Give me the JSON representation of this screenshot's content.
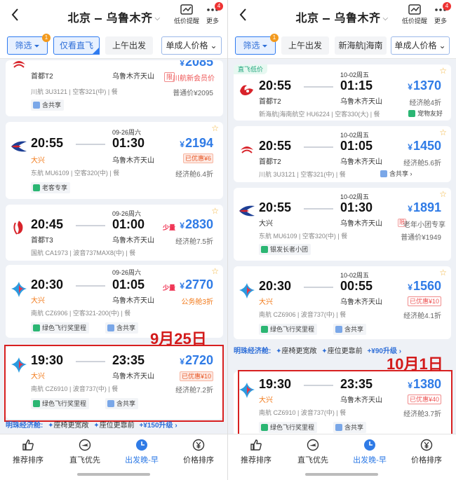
{
  "left": {
    "header": {
      "from": "北京",
      "to": "乌鲁木齐",
      "low_price_label": "低价提醒",
      "more_label": "更多",
      "more_badge": "4"
    },
    "filters": [
      {
        "label": "筛选",
        "badge": "1",
        "funnel": "⏷"
      },
      {
        "label": "仅看直飞"
      },
      {
        "label": "上午出发"
      },
      {
        "label": "单成人价格",
        "chev": "⌄"
      }
    ],
    "cards": [
      {
        "dep_airport": "首都T2",
        "arr_airport": "乌鲁木齐天山",
        "flight": "川航 3U3121 | 空客321(中) | 餐",
        "price": "2085",
        "tag": "限",
        "tag_text": "川航新会员价",
        "discount": "普通价¥2095",
        "chip": "含共享"
      },
      {
        "date": "09-26周六",
        "dep_time": "20:55",
        "arr_time": "01:30",
        "dep_airport": "大兴",
        "arr_airport": "乌鲁木齐天山",
        "flight": "东航 MU6109 | 空客320(中) | 餐",
        "price": "2194",
        "tag": "已优惠¥6",
        "discount": "经济舱6.4折",
        "chip": "老客专享"
      },
      {
        "date": "09-26周六",
        "dep_time": "20:45",
        "arr_time": "01:00",
        "dep_airport": "首都T3",
        "arr_airport": "乌鲁木齐天山",
        "flight": "国航 CA1973 | 波音737MAX8(中) | 餐",
        "price": "2830",
        "few": "少量",
        "discount": "经济舱7.5折"
      },
      {
        "date": "09-26周六",
        "dep_time": "20:30",
        "arr_time": "01:05",
        "dep_airport": "大兴",
        "arr_airport": "乌鲁木齐天山",
        "flight": "南航 CZ6906 | 空客321-200(中) | 餐",
        "price": "2770",
        "few": "少量",
        "discount": "公务舱3折",
        "chip": "绿色飞行奖里程",
        "chip_b": "含共享"
      },
      {
        "dep_time": "19:30",
        "arr_time": "23:35",
        "dep_airport": "大兴",
        "arr_airport": "乌鲁木齐天山",
        "flight": "南航 CZ6910 | 波音737(中) | 餐",
        "price": "2720",
        "tag": "已优惠¥10",
        "discount": "经济舱7.2折",
        "chip": "绿色飞行奖里程",
        "chip_b": "含共享"
      }
    ],
    "promo": {
      "label": "明珠经济舱:",
      "a": "座椅更宽敞",
      "b": "座位更靠前",
      "up": "+¥150升级 ›"
    },
    "annotation": "9月25日",
    "nav": [
      "推荐排序",
      "直飞优先",
      "出发晚-早",
      "价格排序"
    ]
  },
  "right": {
    "header": {
      "from": "北京",
      "to": "乌鲁木齐",
      "low_price_label": "低价提醒",
      "more_label": "更多",
      "more_badge": "4"
    },
    "filters": [
      {
        "label": "筛选",
        "badge": "1",
        "funnel": "⏷"
      },
      {
        "label": "上午出发"
      },
      {
        "label": "新海航|海南"
      },
      {
        "label": "单成人价格",
        "chev": "⌄"
      }
    ],
    "cards": [
      {
        "badge": "直飞低价",
        "date": "10-02周五",
        "dep_time": "20:55",
        "arr_time": "01:15",
        "dep_airport": "首都T2",
        "arr_airport": "乌鲁木齐天山",
        "flight": "新海航|海南航空 HU6224 | 空客330(大) | 餐",
        "price": "1370",
        "discount": "经济舱4折",
        "chip": "宠物友好"
      },
      {
        "date": "10-02周五",
        "dep_time": "20:55",
        "arr_time": "01:05",
        "dep_airport": "首都T2",
        "arr_airport": "乌鲁木齐天山",
        "flight": "川航 3U3121 | 空客321(中) | 餐",
        "price": "1450",
        "discount": "经济舱5.6折",
        "chip": "含共享 ›"
      },
      {
        "date": "10-02周五",
        "dep_time": "20:55",
        "arr_time": "01:30",
        "dep_airport": "大兴",
        "arr_airport": "乌鲁木齐天山",
        "flight": "东航 MU6109 | 空客320(中) | 餐",
        "price": "1891",
        "tag": "限",
        "tag_text": "老年小团专享",
        "discount": "普通价¥1949",
        "chip": "银发长者小团"
      },
      {
        "date": "10-02周五",
        "dep_time": "20:30",
        "arr_time": "00:55",
        "dep_airport": "大兴",
        "arr_airport": "乌鲁木齐天山",
        "flight": "南航 CZ6906 | 波音737(中) | 餐",
        "price": "1560",
        "tag": "已优惠¥10",
        "discount": "经济舱4.1折",
        "chip": "绿色飞行奖里程",
        "chip_b": "含共享"
      },
      {
        "dep_time": "19:30",
        "arr_time": "23:35",
        "dep_airport": "大兴",
        "arr_airport": "乌鲁木齐天山",
        "flight": "南航 CZ6910 | 波音737(中) | 餐",
        "price": "1380",
        "tag": "已优惠¥40",
        "discount": "经济舱3.7折",
        "chip": "绿色飞行奖里程",
        "chip_b": "含共享"
      }
    ],
    "promo": {
      "label": "明珠经济舱:",
      "a": "座椅更宽敞",
      "b": "座位更靠前",
      "up": "+¥90升级 ›"
    },
    "annotation": "10月1日",
    "nav": [
      "推荐排序",
      "直飞优先",
      "出发晚-早",
      "价格排序"
    ]
  },
  "colors": {
    "accent": "#2f7be6",
    "annotation_red": "#d31a1a",
    "orange": "#f27a1a"
  }
}
